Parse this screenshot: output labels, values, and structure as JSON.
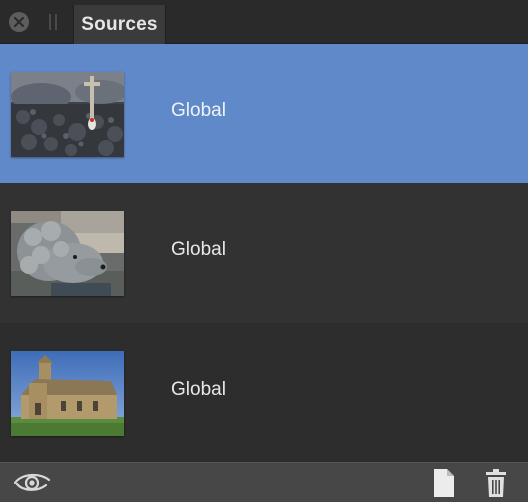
{
  "panel": {
    "tab_title": "Sources"
  },
  "sources": [
    {
      "label": "Global",
      "thumbnail": "cross-garden-photo",
      "selected": true
    },
    {
      "label": "Global",
      "thumbnail": "poodle-photo",
      "selected": false
    },
    {
      "label": "Global",
      "thumbnail": "church-photo",
      "selected": false
    }
  ],
  "footer": {
    "icons": [
      "eye-icon",
      "new-document-icon",
      "trash-icon"
    ]
  },
  "colors": {
    "selection": "#6089c9",
    "panel_bg": "#323232",
    "footer_bg": "#474747"
  }
}
